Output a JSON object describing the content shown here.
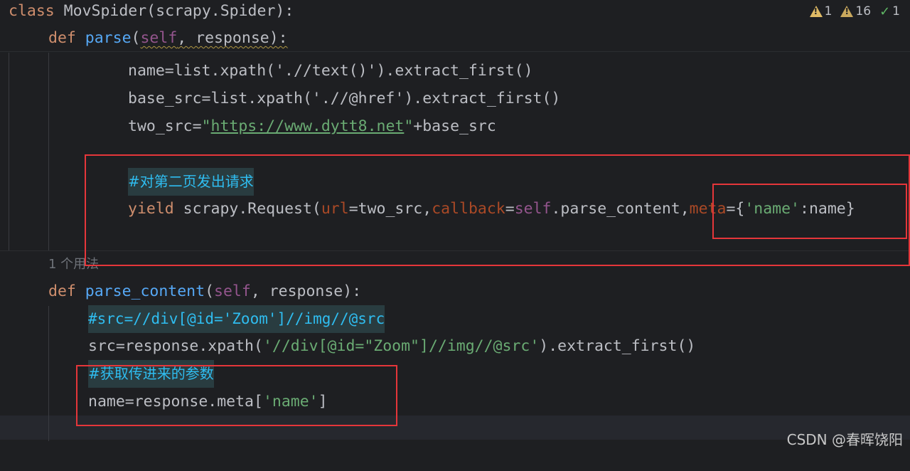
{
  "inspections": {
    "warnings": "1",
    "weak_warnings": "16",
    "typos": "1"
  },
  "code": {
    "line1": {
      "kw": "class",
      "name": " MovSpider(scrapy.Spider):"
    },
    "line2": {
      "kw": "def",
      "fn": "parse",
      "open": "(",
      "self": "self",
      "rest": ", response):"
    },
    "line3": "name=list.xpath('.//text()').extract_first()",
    "line4": "base_src=list.xpath('.//@href').extract_first()",
    "line5": {
      "pre": "two_src=",
      "q1": "\"",
      "url": "https://www.dytt8.net",
      "q2": "\"",
      "post": "+base_src"
    },
    "line6_comment": "#对第二页发出请求",
    "line7": {
      "kw": "yield",
      "a": " scrapy.Request(",
      "p1": "url",
      "b": "=two_src,",
      "p2": "callback",
      "c": "=",
      "self": "self",
      "d": ".parse_content,",
      "p3": "meta",
      "e": "={",
      "s1": "'name'",
      "f": ":name}"
    },
    "usage_hint": "1 个用法",
    "line8": {
      "kw": "def",
      "fn": "parse_content",
      "open": "(",
      "self": "self",
      "rest": ", response):"
    },
    "line9_comment": "#src=//div[@id='Zoom']//img//@src",
    "line10": {
      "pre": "src=response.xpath(",
      "str": "'//div[@id=\"Zoom\"]//img//@src'",
      "post": ").extract_first()"
    },
    "line11_comment": "#获取传进来的参数",
    "line12": {
      "pre": "name=response.meta[",
      "str": "'name'",
      "post": "]"
    }
  },
  "watermark": "CSDN @春晖饶阳",
  "colors": {
    "background": "#1e1f22",
    "keyword": "#cf8e6d",
    "function": "#56a8f5",
    "string": "#6aab73",
    "comment": "#2fbdf0",
    "highlight_box": "#e5363a"
  }
}
